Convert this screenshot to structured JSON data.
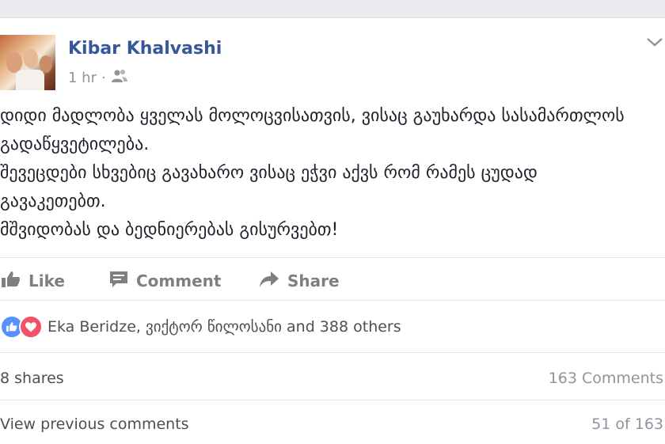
{
  "post": {
    "author": "Kibar Khalvashi",
    "time": "1 hr",
    "time_sep": "·",
    "audience_icon": "friends-icon",
    "options_icon": "chevron-down-icon",
    "text_lines": [
      "დიდი მადლობა ყველას მოლოცვისათვის, ვისაც გაუხარდა სასამართლოს",
      "გადაწყვეტილება.",
      "შევეცდები სხვებიც გავახარო ვისაც ეჭვი აქვს რომ რამეს ცუდად",
      "გავაკეთებთ.",
      "მშვიდობას და ბედნიერებას გისურვებთ!"
    ]
  },
  "actions": {
    "like": "Like",
    "comment": "Comment",
    "share": "Share"
  },
  "reactions": {
    "icons": [
      "like-reaction-icon",
      "love-reaction-icon"
    ],
    "names": "Eka Beridze, ვიქტორ წილოსანი and 388 others"
  },
  "stats": {
    "shares": "8 shares",
    "comments": "163 Comments"
  },
  "comments": {
    "view_previous": "View previous comments",
    "pager": "51 of 163"
  },
  "colors": {
    "link_blue": "#365899",
    "like_blue": "#5890ff",
    "love_red": "#f25268",
    "muted": "#90949c"
  }
}
